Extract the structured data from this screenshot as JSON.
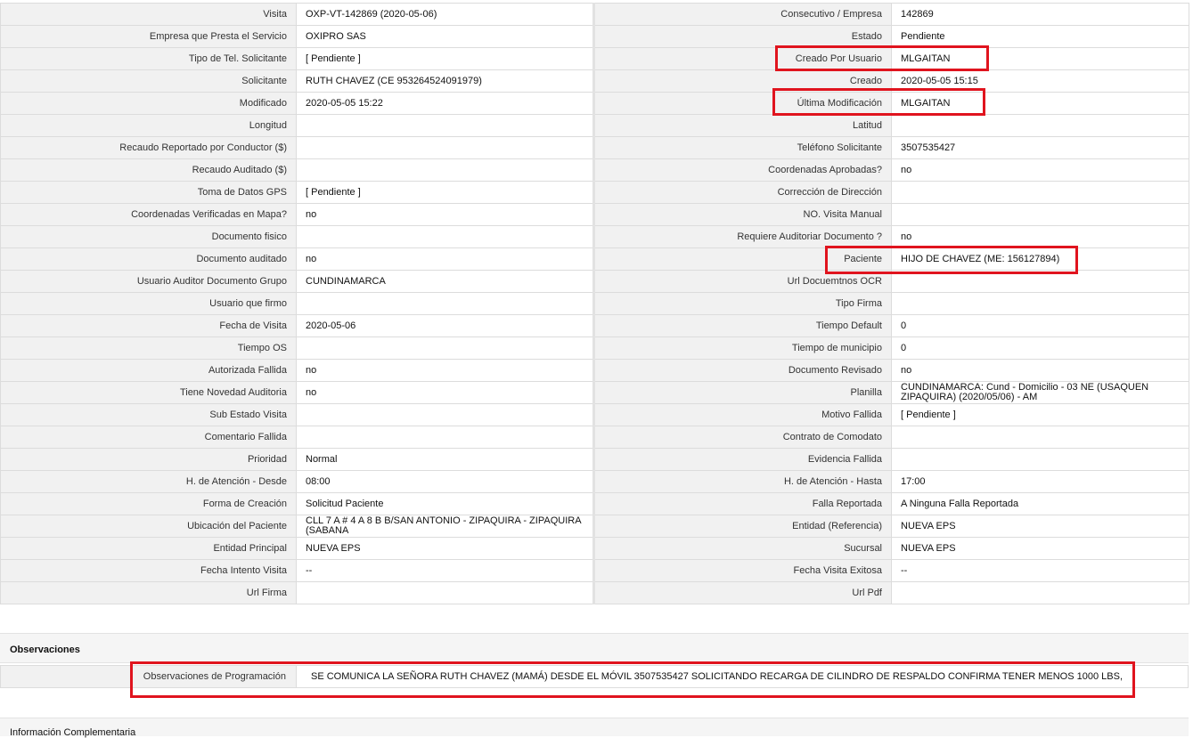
{
  "rows": [
    {
      "l1": "Visita",
      "v1": "OXP-VT-142869 (2020-05-06)",
      "l2": "Consecutivo / Empresa",
      "v2": "142869"
    },
    {
      "l1": "Empresa que Presta el Servicio",
      "v1": "OXIPRO SAS",
      "l2": "Estado",
      "v2": "Pendiente"
    },
    {
      "l1": "Tipo de Tel. Solicitante",
      "v1": "[ Pendiente ]",
      "l2": "Creado Por Usuario",
      "v2": "MLGAITAN"
    },
    {
      "l1": "Solicitante",
      "v1": "RUTH CHAVEZ (CE 953264524091979)",
      "l2": "Creado",
      "v2": "2020-05-05 15:15"
    },
    {
      "l1": "Modificado",
      "v1": "2020-05-05 15:22",
      "l2": "Última Modificación",
      "v2": " MLGAITAN"
    },
    {
      "l1": "Longitud",
      "v1": "",
      "l2": "Latitud",
      "v2": ""
    },
    {
      "l1": "Recaudo Reportado por Conductor ($)",
      "v1": "",
      "l2": "Teléfono Solicitante",
      "v2": "3507535427"
    },
    {
      "l1": "Recaudo Auditado ($)",
      "v1": "",
      "l2": "Coordenadas Aprobadas?",
      "v2": " no"
    },
    {
      "l1": "Toma de Datos GPS",
      "v1": "[ Pendiente ]",
      "l2": "Corrección de Dirección",
      "v2": ""
    },
    {
      "l1": "Coordenadas Verificadas en Mapa?",
      "v1": " no",
      "l2": "NO. Visita Manual",
      "v2": ""
    },
    {
      "l1": "Documento fisico",
      "v1": "",
      "l2": "Requiere Auditoriar Documento ?",
      "v2": " no"
    },
    {
      "l1": "Documento auditado",
      "v1": " no",
      "l2": "Paciente",
      "v2": "HIJO DE CHAVEZ (ME: 156127894)"
    },
    {
      "l1": "Usuario Auditor Documento Grupo",
      "v1": "CUNDINAMARCA",
      "l2": "Url Docuemtnos OCR",
      "v2": ""
    },
    {
      "l1": "Usuario que firmo",
      "v1": "",
      "l2": "Tipo Firma",
      "v2": ""
    },
    {
      "l1": "Fecha de Visita",
      "v1": " 2020-05-06",
      "l2": "Tiempo Default",
      "v2": "0"
    },
    {
      "l1": "Tiempo OS",
      "v1": "",
      "l2": "Tiempo de municipio",
      "v2": "0"
    },
    {
      "l1": "Autorizada Fallida",
      "v1": " no",
      "l2": "Documento Revisado",
      "v2": " no"
    },
    {
      "l1": "Tiene Novedad Auditoria",
      "v1": " no",
      "l2": "Planilla",
      "v2": "CUNDINAMARCA: Cund - Domicilio - 03 NE (USAQUEN ZIPAQUIRA) (2020/05/06) - AM"
    },
    {
      "l1": "Sub Estado Visita",
      "v1": "",
      "l2": "Motivo Fallida",
      "v2": "[ Pendiente ]"
    },
    {
      "l1": "Comentario Fallida",
      "v1": "",
      "l2": "Contrato de Comodato",
      "v2": ""
    },
    {
      "l1": "Prioridad",
      "v1": "Normal",
      "l2": "Evidencia Fallida",
      "v2": ""
    },
    {
      "l1": "H. de Atención - Desde",
      "v1": "08:00",
      "l2": "H. de Atención - Hasta",
      "v2": "17:00"
    },
    {
      "l1": "Forma de Creación",
      "v1": "Solicitud Paciente",
      "l2": "Falla Reportada",
      "v2": "A Ninguna Falla Reportada"
    },
    {
      "l1": "Ubicación del Paciente",
      "v1": "CLL 7 A # 4 A 8 B B/SAN ANTONIO - ZIPAQUIRA - ZIPAQUIRA (SABANA",
      "l2": "Entidad (Referencia)",
      "v2": "NUEVA EPS"
    },
    {
      "l1": "Entidad Principal",
      "v1": "NUEVA EPS",
      "l2": "Sucursal",
      "v2": "NUEVA EPS"
    },
    {
      "l1": "Fecha Intento Visita",
      "v1": " --",
      "l2": "Fecha Visita Exitosa",
      "v2": " --"
    },
    {
      "l1": "Url Firma",
      "v1": "",
      "l2": "Url Pdf",
      "v2": ""
    }
  ],
  "observaciones": {
    "title": "Observaciones",
    "label": "Observaciones de Programación",
    "value": "SE COMUNICA LA SEÑORA RUTH CHAVEZ (MAMÁ) DESDE EL MÓVIL 3507535427 SOLICITANDO RECARGA DE CILINDRO DE RESPALDO CONFIRMA TENER MENOS 1000 LBS,"
  },
  "next_section": {
    "title": "Información Complementaria"
  },
  "highlight_color": "#e0141e"
}
